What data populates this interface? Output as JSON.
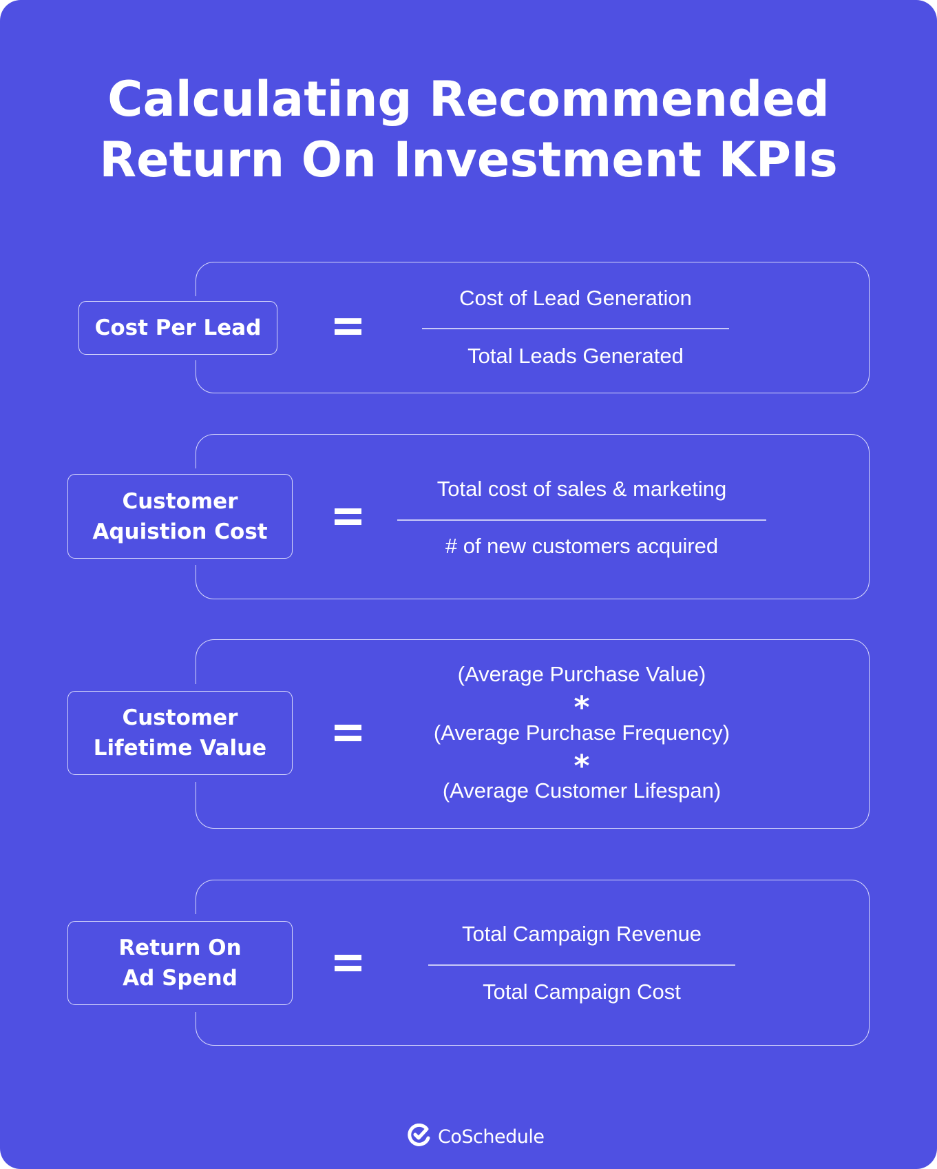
{
  "title": {
    "line1": "Calculating Recommended",
    "line2": "Return On Investment KPIs"
  },
  "colors": {
    "background": "#4F50E2",
    "text": "#FFFFFF",
    "stroke": "#D9DAFB"
  },
  "rows": [
    {
      "label": "Cost Per Lead",
      "operator": "=",
      "numerator": "Cost of Lead Generation",
      "denominator": "Total Leads Generated"
    },
    {
      "label_line1": "Customer",
      "label_line2": "Aquistion Cost",
      "operator": "=",
      "numerator": "Total cost of sales & marketing",
      "denominator": "# of new customers acquired"
    },
    {
      "label_line1": "Customer",
      "label_line2": "Lifetime Value",
      "operator": "=",
      "terms": [
        "(Average Purchase Value)",
        "(Average Purchase Frequency)",
        "(Average Customer Lifespan)"
      ],
      "multiply_symbol": "*"
    },
    {
      "label_line1": "Return On",
      "label_line2": "Ad Spend",
      "operator": "=",
      "numerator": "Total Campaign Revenue",
      "denominator": "Total Campaign Cost"
    }
  ],
  "footer": {
    "logo_icon": "coschedule-check-icon",
    "brand": "CoSchedule"
  }
}
